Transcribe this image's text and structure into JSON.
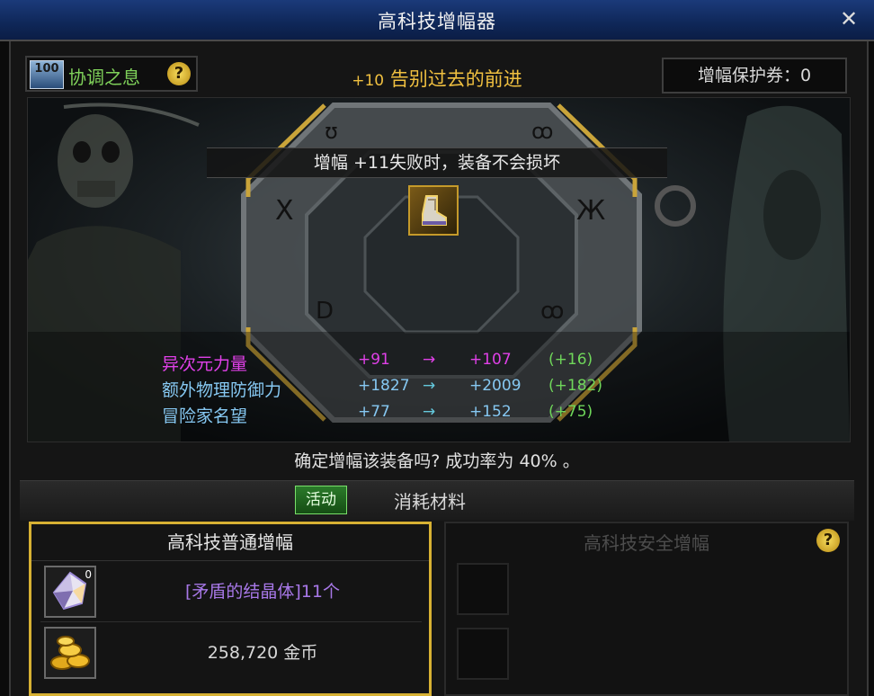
{
  "window": {
    "title": "高科技增幅器",
    "close_symbol": "✕"
  },
  "badge": {
    "level": "100",
    "name": "协调之息",
    "help_symbol": "?"
  },
  "headline": {
    "plus": "+10",
    "text": "告别过去的前进"
  },
  "voucher": {
    "text": "增幅保护券：0"
  },
  "stage": {
    "fail_notice": "增幅 +11失败时，装备不会损坏",
    "item_icon": "boot-icon"
  },
  "stats": [
    {
      "label": "异次元力量",
      "from": "+91",
      "arrow": "→",
      "to": "+107",
      "diff": "(+16)",
      "color": "#e040e8"
    },
    {
      "label": "额外物理防御力",
      "from": "+1827",
      "arrow": "→",
      "to": "+2009",
      "diff": "(+182)",
      "color": "#86c8f2"
    },
    {
      "label": "冒险家名望",
      "from": "+77",
      "arrow": "→",
      "to": "+152",
      "diff": "(+75)",
      "color": "#86c8f2"
    }
  ],
  "confirm": "确定增幅该装备吗? 成功率为 40% 。",
  "tabs": {
    "active": "活动",
    "materials": "消耗材料"
  },
  "left_panel": {
    "title": "高科技普通增幅",
    "materials": [
      {
        "icon": "crystal-icon",
        "count": "0",
        "text": "[矛盾的结晶体]11个"
      },
      {
        "icon": "gold-coins-icon",
        "count": "",
        "text": "258,720 金币"
      }
    ]
  },
  "right_panel": {
    "title": "高科技安全增幅",
    "help_symbol": "?"
  }
}
